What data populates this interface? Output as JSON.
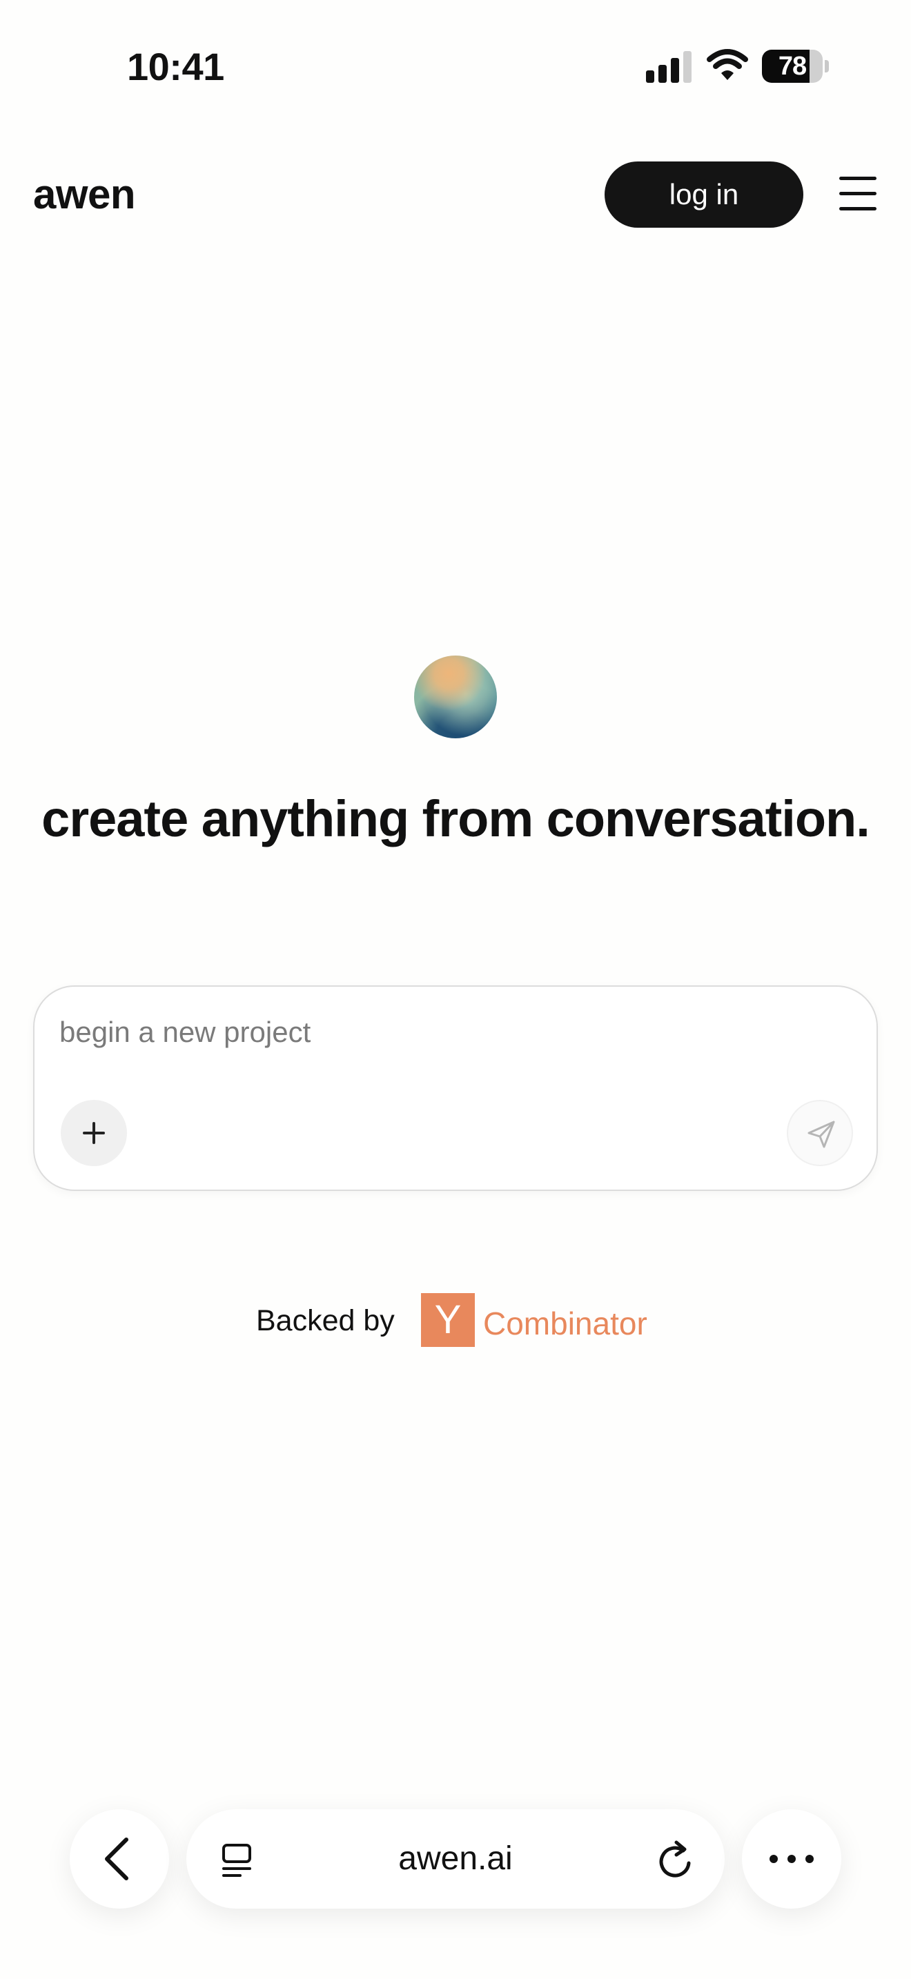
{
  "status_bar": {
    "time": "10:41",
    "battery_level": "78",
    "battery_fraction": 0.78,
    "signal_bars_filled": 3,
    "signal_bars_total": 4
  },
  "header": {
    "brand": "awen",
    "login_label": "log in",
    "menu_icon": "hamburger-menu-icon"
  },
  "hero": {
    "orb_icon": "gradient-orb-icon",
    "tagline": "create anything from conversation."
  },
  "composer": {
    "placeholder": "begin a new project",
    "value": "",
    "attach_icon": "plus-icon",
    "send_icon": "paper-plane-icon"
  },
  "backed": {
    "label": "Backed by",
    "yc_mark": "Y",
    "yc_text": "Combinator"
  },
  "browser_bar": {
    "url": "awen.ai",
    "back_icon": "chevron-left-icon",
    "tabs_icon": "tabs-icon",
    "reload_icon": "reload-icon",
    "more_icon": "ellipsis-icon"
  },
  "colors": {
    "accent_dark": "#141414",
    "yc_orange": "#e8885c",
    "background": "#fefefd",
    "placeholder_gray": "#7a7a7a"
  }
}
